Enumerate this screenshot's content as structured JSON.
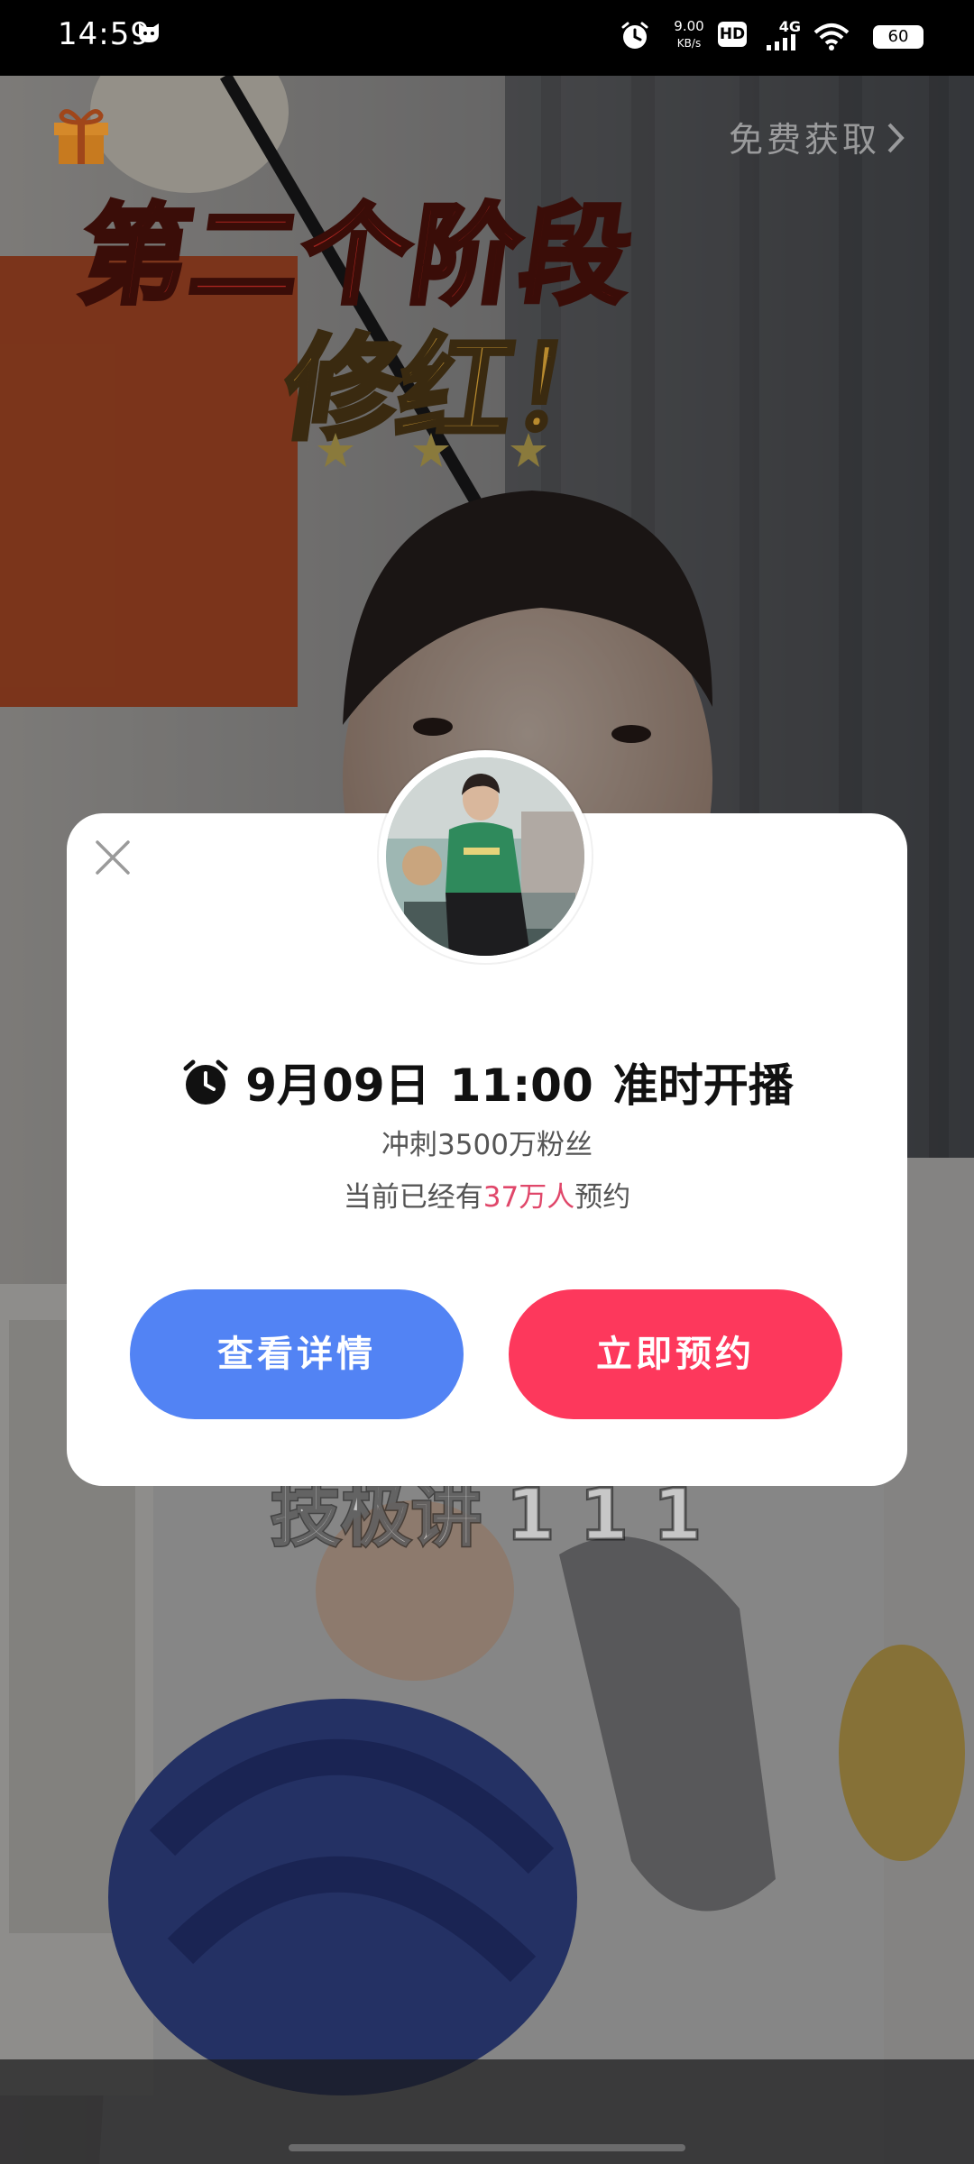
{
  "status_bar": {
    "time": "14:59",
    "net_speed_value": "9.00",
    "net_speed_unit": "KB/s",
    "hd_label": "HD",
    "network": "4G",
    "battery": "60"
  },
  "video": {
    "free_get_label": "免费获取",
    "promo_line_1": "第二个阶段",
    "promo_line_2": "修红！",
    "subtitle_partial": "技极讲  1 1 1"
  },
  "modal": {
    "date": "9月09日",
    "time": "11:00",
    "schedule_suffix": "准时开播",
    "goal_text": "冲刺3500万粉丝",
    "reserved_prefix": "当前已经有",
    "reserved_count": "37万人",
    "reserved_suffix": "预约",
    "details_button": "查看详情",
    "reserve_button": "立即预约"
  },
  "colors": {
    "details_button": "#5283f4",
    "reserve_button": "#fd385c",
    "highlight": "#e0476a"
  },
  "icons": {
    "close": "close-icon",
    "alarm": "alarm-clock-icon",
    "gift": "gift-icon",
    "chevron": "chevron-right-icon"
  }
}
